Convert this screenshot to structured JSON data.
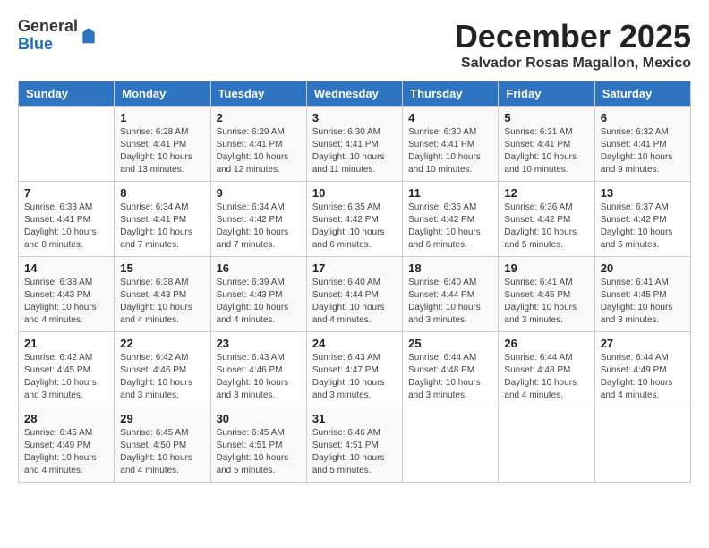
{
  "logo": {
    "general": "General",
    "blue": "Blue"
  },
  "title": "December 2025",
  "subtitle": "Salvador Rosas Magallon, Mexico",
  "days_of_week": [
    "Sunday",
    "Monday",
    "Tuesday",
    "Wednesday",
    "Thursday",
    "Friday",
    "Saturday"
  ],
  "weeks": [
    [
      {
        "day": "",
        "sunrise": "",
        "sunset": "",
        "daylight": ""
      },
      {
        "day": "1",
        "sunrise": "6:28 AM",
        "sunset": "4:41 PM",
        "daylight": "10 hours and 13 minutes."
      },
      {
        "day": "2",
        "sunrise": "6:29 AM",
        "sunset": "4:41 PM",
        "daylight": "10 hours and 12 minutes."
      },
      {
        "day": "3",
        "sunrise": "6:30 AM",
        "sunset": "4:41 PM",
        "daylight": "10 hours and 11 minutes."
      },
      {
        "day": "4",
        "sunrise": "6:30 AM",
        "sunset": "4:41 PM",
        "daylight": "10 hours and 10 minutes."
      },
      {
        "day": "5",
        "sunrise": "6:31 AM",
        "sunset": "4:41 PM",
        "daylight": "10 hours and 10 minutes."
      },
      {
        "day": "6",
        "sunrise": "6:32 AM",
        "sunset": "4:41 PM",
        "daylight": "10 hours and 9 minutes."
      }
    ],
    [
      {
        "day": "7",
        "sunrise": "6:33 AM",
        "sunset": "4:41 PM",
        "daylight": "10 hours and 8 minutes."
      },
      {
        "day": "8",
        "sunrise": "6:34 AM",
        "sunset": "4:41 PM",
        "daylight": "10 hours and 7 minutes."
      },
      {
        "day": "9",
        "sunrise": "6:34 AM",
        "sunset": "4:42 PM",
        "daylight": "10 hours and 7 minutes."
      },
      {
        "day": "10",
        "sunrise": "6:35 AM",
        "sunset": "4:42 PM",
        "daylight": "10 hours and 6 minutes."
      },
      {
        "day": "11",
        "sunrise": "6:36 AM",
        "sunset": "4:42 PM",
        "daylight": "10 hours and 6 minutes."
      },
      {
        "day": "12",
        "sunrise": "6:36 AM",
        "sunset": "4:42 PM",
        "daylight": "10 hours and 5 minutes."
      },
      {
        "day": "13",
        "sunrise": "6:37 AM",
        "sunset": "4:42 PM",
        "daylight": "10 hours and 5 minutes."
      }
    ],
    [
      {
        "day": "14",
        "sunrise": "6:38 AM",
        "sunset": "4:43 PM",
        "daylight": "10 hours and 4 minutes."
      },
      {
        "day": "15",
        "sunrise": "6:38 AM",
        "sunset": "4:43 PM",
        "daylight": "10 hours and 4 minutes."
      },
      {
        "day": "16",
        "sunrise": "6:39 AM",
        "sunset": "4:43 PM",
        "daylight": "10 hours and 4 minutes."
      },
      {
        "day": "17",
        "sunrise": "6:40 AM",
        "sunset": "4:44 PM",
        "daylight": "10 hours and 4 minutes."
      },
      {
        "day": "18",
        "sunrise": "6:40 AM",
        "sunset": "4:44 PM",
        "daylight": "10 hours and 3 minutes."
      },
      {
        "day": "19",
        "sunrise": "6:41 AM",
        "sunset": "4:45 PM",
        "daylight": "10 hours and 3 minutes."
      },
      {
        "day": "20",
        "sunrise": "6:41 AM",
        "sunset": "4:45 PM",
        "daylight": "10 hours and 3 minutes."
      }
    ],
    [
      {
        "day": "21",
        "sunrise": "6:42 AM",
        "sunset": "4:45 PM",
        "daylight": "10 hours and 3 minutes."
      },
      {
        "day": "22",
        "sunrise": "6:42 AM",
        "sunset": "4:46 PM",
        "daylight": "10 hours and 3 minutes."
      },
      {
        "day": "23",
        "sunrise": "6:43 AM",
        "sunset": "4:46 PM",
        "daylight": "10 hours and 3 minutes."
      },
      {
        "day": "24",
        "sunrise": "6:43 AM",
        "sunset": "4:47 PM",
        "daylight": "10 hours and 3 minutes."
      },
      {
        "day": "25",
        "sunrise": "6:44 AM",
        "sunset": "4:48 PM",
        "daylight": "10 hours and 3 minutes."
      },
      {
        "day": "26",
        "sunrise": "6:44 AM",
        "sunset": "4:48 PM",
        "daylight": "10 hours and 4 minutes."
      },
      {
        "day": "27",
        "sunrise": "6:44 AM",
        "sunset": "4:49 PM",
        "daylight": "10 hours and 4 minutes."
      }
    ],
    [
      {
        "day": "28",
        "sunrise": "6:45 AM",
        "sunset": "4:49 PM",
        "daylight": "10 hours and 4 minutes."
      },
      {
        "day": "29",
        "sunrise": "6:45 AM",
        "sunset": "4:50 PM",
        "daylight": "10 hours and 4 minutes."
      },
      {
        "day": "30",
        "sunrise": "6:45 AM",
        "sunset": "4:51 PM",
        "daylight": "10 hours and 5 minutes."
      },
      {
        "day": "31",
        "sunrise": "6:46 AM",
        "sunset": "4:51 PM",
        "daylight": "10 hours and 5 minutes."
      },
      {
        "day": "",
        "sunrise": "",
        "sunset": "",
        "daylight": ""
      },
      {
        "day": "",
        "sunrise": "",
        "sunset": "",
        "daylight": ""
      },
      {
        "day": "",
        "sunrise": "",
        "sunset": "",
        "daylight": ""
      }
    ]
  ]
}
